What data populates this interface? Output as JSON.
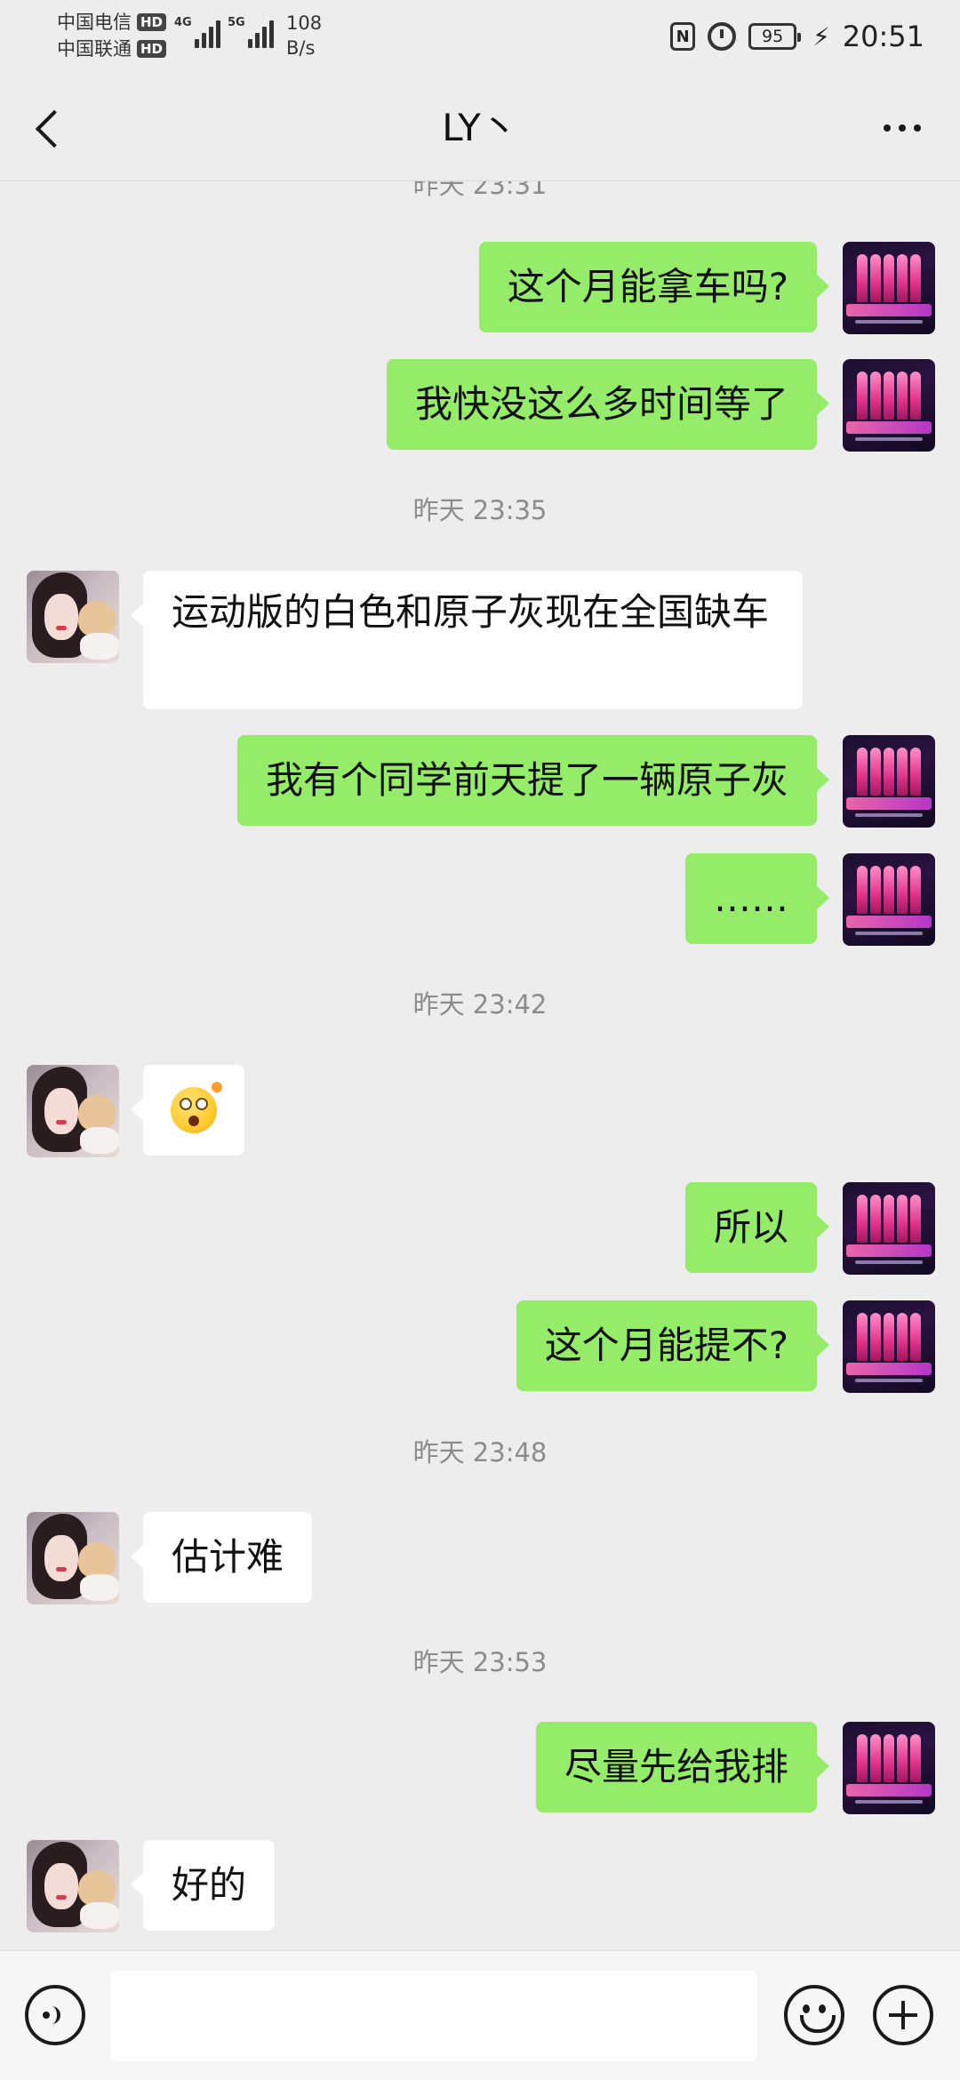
{
  "status_bar": {
    "carrier_1": "中国电信",
    "carrier_2": "中国联通",
    "hd_badge": "HD",
    "network_1": "4G",
    "network_2": "5G",
    "speed_value": "108",
    "speed_unit": "B/s",
    "nfc_label": "N",
    "battery_level": "95",
    "charging_icon": "⚡",
    "time": "20:51"
  },
  "header": {
    "title": "LY丶",
    "back_icon": "chevron-left-icon",
    "more_icon": "more-dots-icon"
  },
  "messages": [
    {
      "type": "timestamp",
      "text": "昨天 23:31"
    },
    {
      "type": "out",
      "text": "这个月能拿车吗?"
    },
    {
      "type": "out",
      "text": "我快没这么多时间等了"
    },
    {
      "type": "timestamp",
      "text": "昨天 23:35"
    },
    {
      "type": "in",
      "text": "运动版的白色和原子灰现在全国缺车"
    },
    {
      "type": "out",
      "text": "我有个同学前天提了一辆原子灰"
    },
    {
      "type": "out",
      "text": "……"
    },
    {
      "type": "timestamp",
      "text": "昨天 23:42"
    },
    {
      "type": "in",
      "emoji": "flushed-face-emoji"
    },
    {
      "type": "out",
      "text": "所以"
    },
    {
      "type": "out",
      "text": "这个月能提不?"
    },
    {
      "type": "timestamp",
      "text": "昨天 23:48"
    },
    {
      "type": "in",
      "text": "估计难"
    },
    {
      "type": "timestamp",
      "text": "昨天 23:53"
    },
    {
      "type": "out",
      "text": "尽量先给我排"
    },
    {
      "type": "in",
      "text": "好的"
    }
  ],
  "input_bar": {
    "voice_icon": "voice-icon",
    "input_value": "",
    "emoji_icon": "emoji-icon",
    "plus_icon": "plus-icon"
  },
  "colors": {
    "background": "#ededed",
    "outgoing_bubble": "#95ec69",
    "incoming_bubble": "#ffffff",
    "timestamp_text": "#8c8c8c"
  }
}
